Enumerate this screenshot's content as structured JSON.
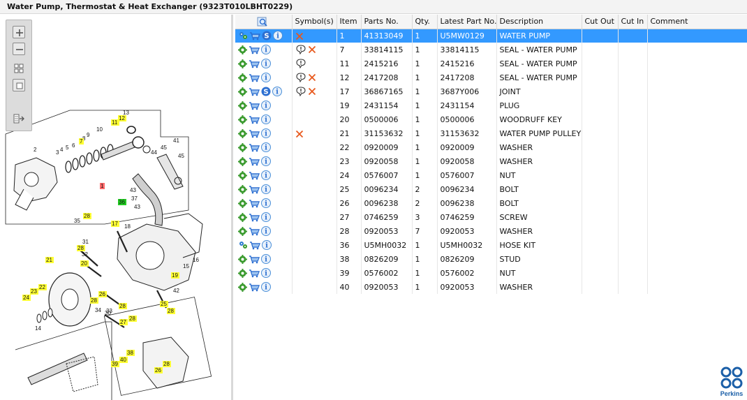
{
  "window": {
    "title": "Water Pump, Thermostat & Heat Exchanger (9323T010LBHT0229)"
  },
  "toolbar": {
    "buttons": [
      {
        "name": "zoom-in-icon"
      },
      {
        "name": "zoom-out-icon"
      },
      {
        "name": "fit-all-icon"
      },
      {
        "name": "fit-window-icon"
      },
      {
        "name": "export-icon"
      }
    ]
  },
  "diagram": {
    "callouts": [
      {
        "label": "13",
        "highlight": "none"
      },
      {
        "label": "12",
        "highlight": "yellow"
      },
      {
        "label": "11",
        "highlight": "yellow"
      },
      {
        "label": "10",
        "highlight": "none"
      },
      {
        "label": "9",
        "highlight": "none"
      },
      {
        "label": "8",
        "highlight": "none"
      },
      {
        "label": "7",
        "highlight": "yellow"
      },
      {
        "label": "6",
        "highlight": "none"
      },
      {
        "label": "5",
        "highlight": "none"
      },
      {
        "label": "4",
        "highlight": "none"
      },
      {
        "label": "3",
        "highlight": "none"
      },
      {
        "label": "2",
        "highlight": "none"
      },
      {
        "label": "1",
        "highlight": "red"
      },
      {
        "label": "41",
        "highlight": "none"
      },
      {
        "label": "45",
        "highlight": "none"
      },
      {
        "label": "44",
        "highlight": "none"
      },
      {
        "label": "45",
        "highlight": "none"
      },
      {
        "label": "43",
        "highlight": "none"
      },
      {
        "label": "36",
        "highlight": "green"
      },
      {
        "label": "37",
        "highlight": "none"
      },
      {
        "label": "43",
        "highlight": "none"
      },
      {
        "label": "28",
        "highlight": "yellow"
      },
      {
        "label": "35",
        "highlight": "none"
      },
      {
        "label": "17",
        "highlight": "yellow"
      },
      {
        "label": "18",
        "highlight": "none"
      },
      {
        "label": "31",
        "highlight": "none"
      },
      {
        "label": "28",
        "highlight": "yellow"
      },
      {
        "label": "32",
        "highlight": "none"
      },
      {
        "label": "20",
        "highlight": "yellow"
      },
      {
        "label": "21",
        "highlight": "yellow"
      },
      {
        "label": "16",
        "highlight": "none"
      },
      {
        "label": "15",
        "highlight": "none"
      },
      {
        "label": "19",
        "highlight": "yellow"
      },
      {
        "label": "42",
        "highlight": "none"
      },
      {
        "label": "22",
        "highlight": "yellow"
      },
      {
        "label": "23",
        "highlight": "yellow"
      },
      {
        "label": "24",
        "highlight": "yellow"
      },
      {
        "label": "26",
        "highlight": "yellow"
      },
      {
        "label": "28",
        "highlight": "yellow"
      },
      {
        "label": "34",
        "highlight": "none"
      },
      {
        "label": "33",
        "highlight": "none"
      },
      {
        "label": "28",
        "highlight": "yellow"
      },
      {
        "label": "30",
        "highlight": "none"
      },
      {
        "label": "25",
        "highlight": "yellow"
      },
      {
        "label": "28",
        "highlight": "yellow"
      },
      {
        "label": "27",
        "highlight": "yellow"
      },
      {
        "label": "28",
        "highlight": "yellow"
      },
      {
        "label": "14",
        "highlight": "none"
      },
      {
        "label": "40",
        "highlight": "yellow"
      },
      {
        "label": "38",
        "highlight": "yellow"
      },
      {
        "label": "39",
        "highlight": "yellow"
      },
      {
        "label": "26",
        "highlight": "yellow"
      },
      {
        "label": "28",
        "highlight": "yellow"
      }
    ]
  },
  "table": {
    "columns": [
      "",
      "Symbol(s)",
      "Item",
      "Parts No.",
      "Qty.",
      "Latest Part No.",
      "Description",
      "Cut Out",
      "Cut In",
      "Comment"
    ],
    "header_icon": "search-parts-icon",
    "rows": [
      {
        "item": "1",
        "part_no": "41313049",
        "qty": "1",
        "latest": "U5MW0129",
        "description": "WATER PUMP",
        "symbols": {
          "balloon": false,
          "cross": true
        },
        "icons": {
          "gear": "multi-gear",
          "cart": true,
          "s_badge": true,
          "info": true
        },
        "selected": true
      },
      {
        "item": "7",
        "part_no": "33814115",
        "qty": "1",
        "latest": "33814115",
        "description": "SEAL - WATER PUMP",
        "symbols": {
          "balloon": true,
          "cross": true
        },
        "icons": {
          "gear": "gear",
          "cart": true,
          "s_badge": false,
          "info": true
        },
        "selected": false
      },
      {
        "item": "11",
        "part_no": "2415216",
        "qty": "1",
        "latest": "2415216",
        "description": "SEAL - WATER PUMP",
        "symbols": {
          "balloon": true,
          "cross": false
        },
        "icons": {
          "gear": "gear",
          "cart": true,
          "s_badge": false,
          "info": true
        },
        "selected": false
      },
      {
        "item": "12",
        "part_no": "2417208",
        "qty": "1",
        "latest": "2417208",
        "description": "SEAL - WATER PUMP",
        "symbols": {
          "balloon": true,
          "cross": true
        },
        "icons": {
          "gear": "gear",
          "cart": true,
          "s_badge": false,
          "info": true
        },
        "selected": false
      },
      {
        "item": "17",
        "part_no": "36867165",
        "qty": "1",
        "latest": "3687Y006",
        "description": "JOINT",
        "symbols": {
          "balloon": true,
          "cross": true
        },
        "icons": {
          "gear": "gear",
          "cart": true,
          "s_badge": true,
          "info": true
        },
        "selected": false
      },
      {
        "item": "19",
        "part_no": "2431154",
        "qty": "1",
        "latest": "2431154",
        "description": "PLUG",
        "symbols": {
          "balloon": false,
          "cross": false
        },
        "icons": {
          "gear": "gear",
          "cart": true,
          "s_badge": false,
          "info": true
        },
        "selected": false
      },
      {
        "item": "20",
        "part_no": "0500006",
        "qty": "1",
        "latest": "0500006",
        "description": "WOODRUFF KEY",
        "symbols": {
          "balloon": false,
          "cross": false
        },
        "icons": {
          "gear": "gear",
          "cart": true,
          "s_badge": false,
          "info": true
        },
        "selected": false
      },
      {
        "item": "21",
        "part_no": "31153632",
        "qty": "1",
        "latest": "31153632",
        "description": "WATER PUMP PULLEY",
        "symbols": {
          "balloon": false,
          "cross": true
        },
        "icons": {
          "gear": "gear",
          "cart": true,
          "s_badge": false,
          "info": true
        },
        "selected": false
      },
      {
        "item": "22",
        "part_no": "0920009",
        "qty": "1",
        "latest": "0920009",
        "description": "WASHER",
        "symbols": {
          "balloon": false,
          "cross": false
        },
        "icons": {
          "gear": "gear",
          "cart": true,
          "s_badge": false,
          "info": true
        },
        "selected": false
      },
      {
        "item": "23",
        "part_no": "0920058",
        "qty": "1",
        "latest": "0920058",
        "description": "WASHER",
        "symbols": {
          "balloon": false,
          "cross": false
        },
        "icons": {
          "gear": "gear",
          "cart": true,
          "s_badge": false,
          "info": true
        },
        "selected": false
      },
      {
        "item": "24",
        "part_no": "0576007",
        "qty": "1",
        "latest": "0576007",
        "description": "NUT",
        "symbols": {
          "balloon": false,
          "cross": false
        },
        "icons": {
          "gear": "gear",
          "cart": true,
          "s_badge": false,
          "info": true
        },
        "selected": false
      },
      {
        "item": "25",
        "part_no": "0096234",
        "qty": "2",
        "latest": "0096234",
        "description": "BOLT",
        "symbols": {
          "balloon": false,
          "cross": false
        },
        "icons": {
          "gear": "gear",
          "cart": true,
          "s_badge": false,
          "info": true
        },
        "selected": false
      },
      {
        "item": "26",
        "part_no": "0096238",
        "qty": "2",
        "latest": "0096238",
        "description": "BOLT",
        "symbols": {
          "balloon": false,
          "cross": false
        },
        "icons": {
          "gear": "gear",
          "cart": true,
          "s_badge": false,
          "info": true
        },
        "selected": false
      },
      {
        "item": "27",
        "part_no": "0746259",
        "qty": "3",
        "latest": "0746259",
        "description": "SCREW",
        "symbols": {
          "balloon": false,
          "cross": false
        },
        "icons": {
          "gear": "gear",
          "cart": true,
          "s_badge": false,
          "info": true
        },
        "selected": false
      },
      {
        "item": "28",
        "part_no": "0920053",
        "qty": "7",
        "latest": "0920053",
        "description": "WASHER",
        "symbols": {
          "balloon": false,
          "cross": false
        },
        "icons": {
          "gear": "gear",
          "cart": true,
          "s_badge": false,
          "info": true
        },
        "selected": false
      },
      {
        "item": "36",
        "part_no": "U5MH0032",
        "qty": "1",
        "latest": "U5MH0032",
        "description": "HOSE KIT",
        "symbols": {
          "balloon": false,
          "cross": false
        },
        "icons": {
          "gear": "multi-gear",
          "cart": true,
          "s_badge": false,
          "info": true
        },
        "selected": false
      },
      {
        "item": "38",
        "part_no": "0826209",
        "qty": "1",
        "latest": "0826209",
        "description": "STUD",
        "symbols": {
          "balloon": false,
          "cross": false
        },
        "icons": {
          "gear": "gear",
          "cart": true,
          "s_badge": false,
          "info": true
        },
        "selected": false
      },
      {
        "item": "39",
        "part_no": "0576002",
        "qty": "1",
        "latest": "0576002",
        "description": "NUT",
        "symbols": {
          "balloon": false,
          "cross": false
        },
        "icons": {
          "gear": "gear",
          "cart": true,
          "s_badge": false,
          "info": true
        },
        "selected": false
      },
      {
        "item": "40",
        "part_no": "0920053",
        "qty": "1",
        "latest": "0920053",
        "description": "WASHER",
        "symbols": {
          "balloon": false,
          "cross": false
        },
        "icons": {
          "gear": "gear",
          "cart": true,
          "s_badge": false,
          "info": true
        },
        "selected": false
      }
    ]
  },
  "brand": {
    "name": "Perkins",
    "color": "#1b5fa8"
  },
  "colors": {
    "selection": "#3399ff",
    "highlight_yellow": "#ffff33",
    "highlight_red": "#ff6b6b",
    "highlight_green": "#22cc22",
    "cross_orange": "#e8581c",
    "gear_green": "#3a9a2e",
    "cart_blue": "#2c6fd1",
    "info_blue": "#4a8fd8"
  }
}
